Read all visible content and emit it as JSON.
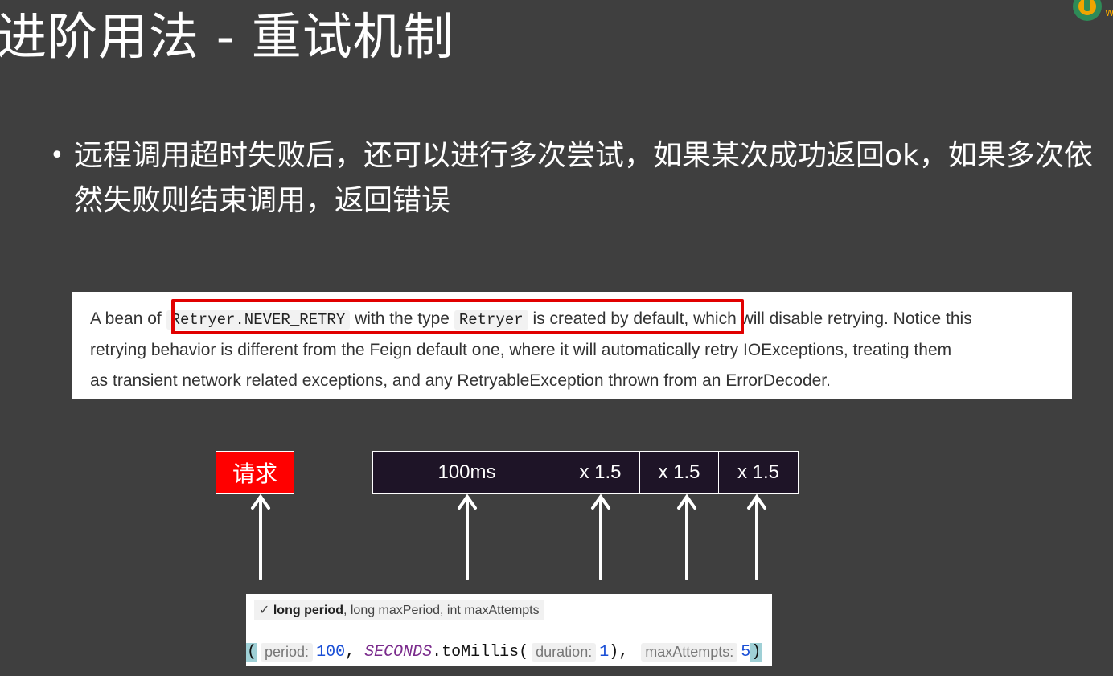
{
  "slide": {
    "title": "进阶用法 - 重试机制",
    "bullet": "远程调用超时失败后，还可以进行多次尝试，如果某次成功返回ok，如果多次依然失败则结束调用，返回错误"
  },
  "doc": {
    "line1_a": "A bean of ",
    "line1_code1": "Retryer.NEVER_RETRY",
    "line1_b": " with the type ",
    "line1_code2": "Retryer",
    "line1_c": " is created by default",
    "line1_d": ", which will disable retrying. Notice this",
    "line2": "retrying behavior is different from the Feign default one, where it will automatically retry IOExceptions, treating them",
    "line3": "as transient network related exceptions, and any RetryableException thrown from an ErrorDecoder."
  },
  "diagram": {
    "request_label": "请求",
    "segments": [
      "100ms",
      "x 1.5",
      "x 1.5",
      "x 1.5"
    ]
  },
  "ide": {
    "tooltip_check": "✓",
    "tooltip_bold": "long period",
    "tooltip_rest": ", long maxPeriod, int maxAttempts",
    "paren_open": "(",
    "hint_period": "period:",
    "val_period": "100",
    "comma1": ",",
    "constant": "SECONDS",
    "method": ".toMillis(",
    "hint_duration": "duration:",
    "val_duration": "1",
    "close1": "),",
    "hint_max": "maxAttempts:",
    "val_max": "5",
    "paren_close": ")"
  },
  "colors": {
    "background": "#3f3f3f",
    "request": "#ff0000",
    "highlight_box": "#e10000",
    "segment_bg": "#1e1427"
  }
}
